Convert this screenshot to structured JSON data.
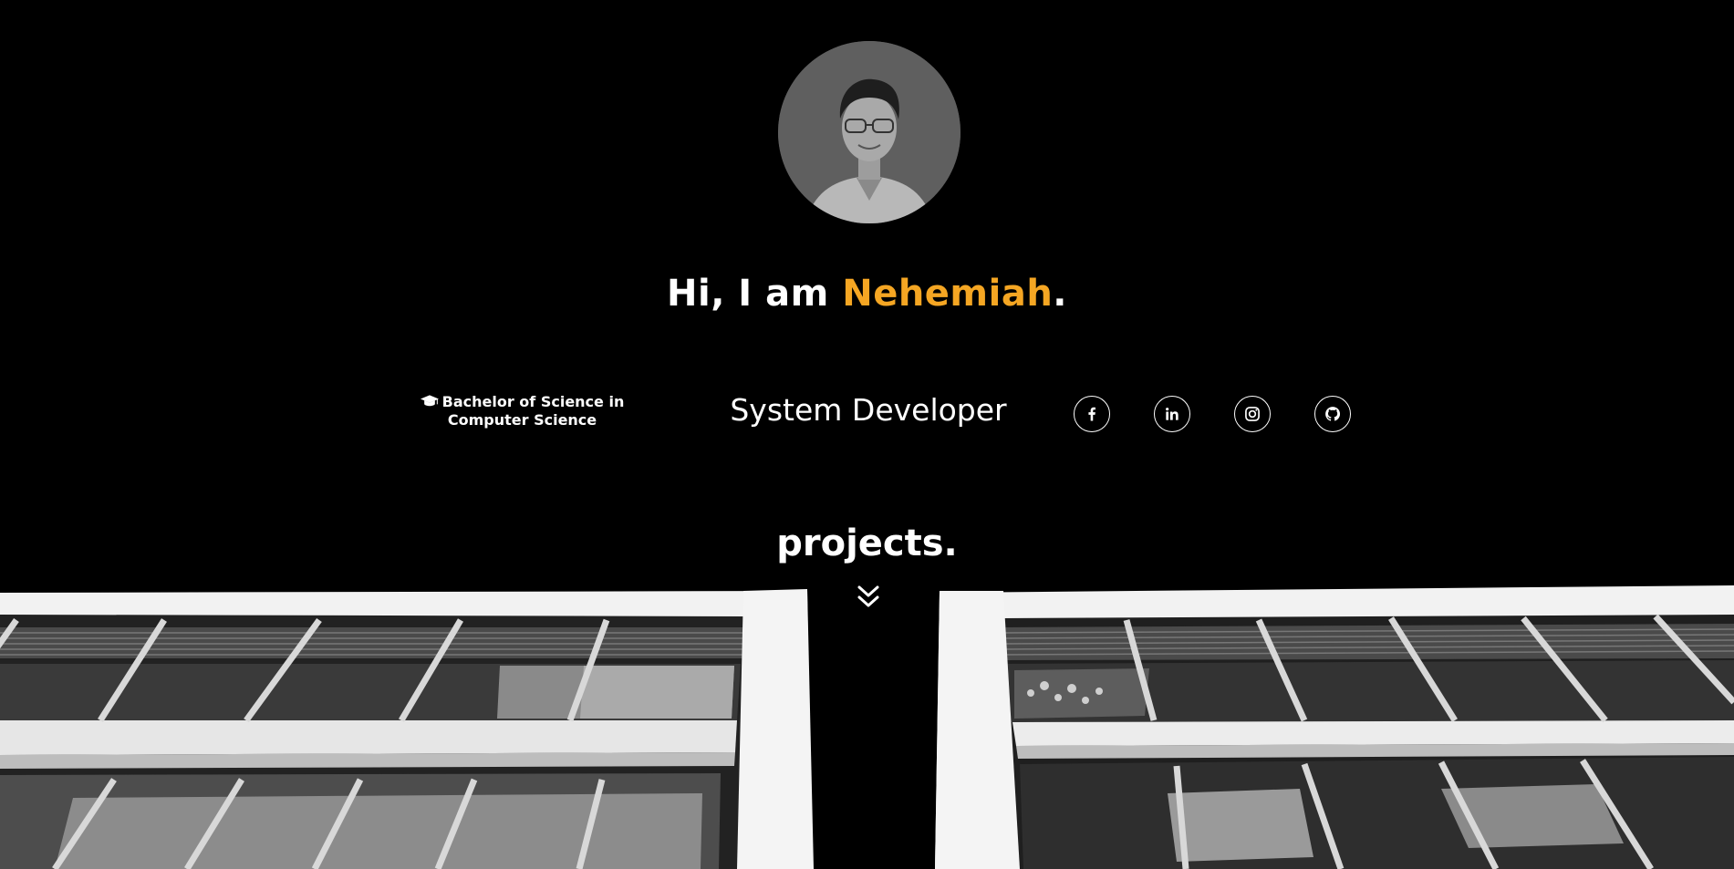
{
  "hero": {
    "greeting_prefix": "Hi, I am ",
    "name": "Nehemiah",
    "greeting_suffix": ".",
    "degree": "Bachelor of Science in Computer Science",
    "role": "System Developer",
    "socials": [
      {
        "icon": "facebook-icon"
      },
      {
        "icon": "linkedin-icon"
      },
      {
        "icon": "instagram-icon"
      },
      {
        "icon": "github-icon"
      }
    ]
  },
  "projects": {
    "heading": "projects."
  },
  "colors": {
    "background": "#000000",
    "text": "#ffffff",
    "accent": "#f5a623"
  }
}
